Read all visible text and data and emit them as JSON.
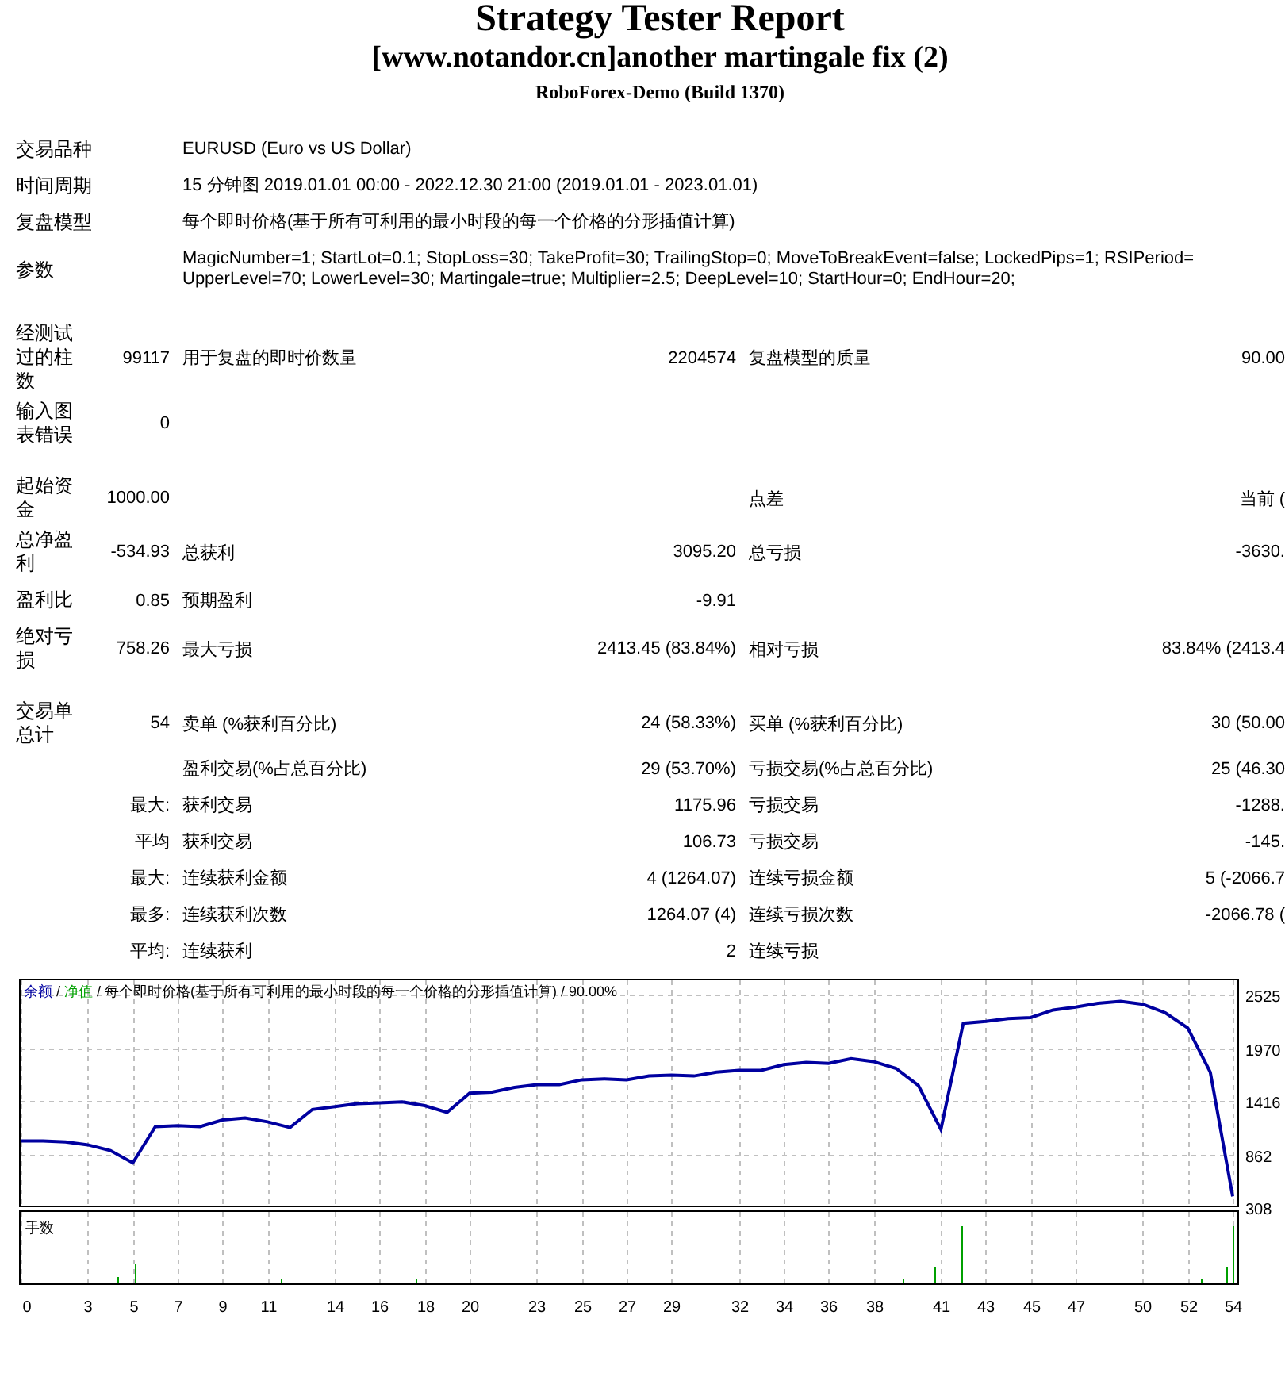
{
  "header": {
    "title": "Strategy Tester Report",
    "subtitle": "[www.notandor.cn]another martingale fix (2)",
    "server": "RoboForex-Demo (Build 1370)"
  },
  "info": [
    {
      "label": "交易品种",
      "value": "EURUSD (Euro vs US Dollar)"
    },
    {
      "label": "时间周期",
      "value": "15 分钟图 2019.01.01 00:00 - 2022.12.30 21:00 (2019.01.01 - 2023.01.01)"
    },
    {
      "label": "复盘模型",
      "value": "每个即时价格(基于所有可利用的最小时段的每一个价格的分形插值计算)"
    },
    {
      "label": "参数",
      "value": "MagicNumber=1; StartLot=0.1; StopLoss=30; TakeProfit=30; TrailingStop=0; MoveToBreakEvent=false; LockedPips=1; RSIPeriod= UpperLevel=70; LowerLevel=30; Martingale=true; Multiplier=2.5; DeepLevel=10; StartHour=0; EndHour=20;"
    }
  ],
  "sections": [
    [
      {
        "label": "经测试过的柱数",
        "value": "99117",
        "pairs": [
          {
            "label": "用于复盘的即时价数量",
            "value": "2204574"
          },
          {
            "label": "复盘模型的质量",
            "value": "90.00"
          }
        ]
      },
      {
        "label": "输入图表错误",
        "value": "0"
      }
    ],
    [
      {
        "label": "起始资金",
        "value": "1000.00",
        "right": {
          "label": "点差",
          "value": "当前 ("
        }
      },
      {
        "label": "总净盈利",
        "value": "-534.93",
        "pairs": [
          {
            "label": "总获利",
            "value": "3095.20"
          },
          {
            "label": "总亏损",
            "value": "-3630."
          }
        ]
      },
      {
        "label": "盈利比",
        "value": "0.85",
        "pairs": [
          {
            "label": "预期盈利",
            "value": "-9.91"
          }
        ]
      },
      {
        "label": "绝对亏损",
        "value": "758.26",
        "pairs": [
          {
            "label": "最大亏损",
            "value": "2413.45 (83.84%)"
          },
          {
            "label": "相对亏损",
            "value": "83.84% (2413.4"
          }
        ]
      }
    ],
    [
      {
        "label": "交易单总计",
        "value": "54",
        "pairs": [
          {
            "label": "卖单 (%获利百分比)",
            "value": "24 (58.33%)"
          },
          {
            "label": "买单 (%获利百分比)",
            "value": "30 (50.00"
          }
        ]
      },
      {
        "pairs": [
          {
            "label": "盈利交易(%占总百分比)",
            "value": "29 (53.70%)"
          },
          {
            "label": "亏损交易(%占总百分比)",
            "value": "25 (46.30"
          }
        ]
      },
      {
        "value": "最大:",
        "pairs": [
          {
            "label": "获利交易",
            "value": "1175.96"
          },
          {
            "label": "亏损交易",
            "value": "-1288."
          }
        ]
      },
      {
        "value": "平均",
        "pairs": [
          {
            "label": "获利交易",
            "value": "106.73"
          },
          {
            "label": "亏损交易",
            "value": "-145."
          }
        ]
      },
      {
        "value": "最大:",
        "pairs": [
          {
            "label": "连续获利金额",
            "value": "4 (1264.07)"
          },
          {
            "label": "连续亏损金额",
            "value": "5 (-2066.7"
          }
        ]
      },
      {
        "value": "最多:",
        "pairs": [
          {
            "label": "连续获利次数",
            "value": "1264.07 (4)"
          },
          {
            "label": "连续亏损次数",
            "value": "-2066.78 ("
          }
        ]
      },
      {
        "value": "平均:",
        "pairs": [
          {
            "label": "连续获利",
            "value": "2"
          },
          {
            "label": "连续亏损"
          }
        ]
      }
    ]
  ],
  "chart": {
    "legend": [
      {
        "text": " / ",
        "color": "#000000"
      },
      {
        "text": "净值",
        "color": "#00a000"
      },
      {
        "text": " / 每个即时价格(基于所有可利用的最小时段的每一个价格的分形插值计算) / 90.00%",
        "color": "#000000"
      }
    ],
    "volume_label": "手数",
    "chart_data": {
      "type": "line",
      "x": [
        0,
        1,
        2,
        3,
        4,
        5,
        6,
        7,
        8,
        9,
        10,
        11,
        12,
        13,
        14,
        15,
        16,
        17,
        18,
        19,
        20,
        21,
        22,
        23,
        24,
        25,
        26,
        27,
        28,
        29,
        30,
        31,
        32,
        33,
        34,
        35,
        36,
        37,
        38,
        39,
        40,
        41,
        42,
        43,
        44,
        45,
        46,
        47,
        48,
        49,
        50,
        51,
        52,
        53,
        54
      ],
      "series": [
        {
          "name": "余额",
          "color": "#0000a0",
          "values": [
            1000,
            1000,
            990,
            960,
            900,
            770,
            1150,
            1160,
            1150,
            1220,
            1240,
            1200,
            1140,
            1330,
            1360,
            1390,
            1400,
            1410,
            1370,
            1300,
            1500,
            1510,
            1560,
            1590,
            1590,
            1640,
            1650,
            1640,
            1680,
            1690,
            1680,
            1720,
            1740,
            1740,
            1800,
            1820,
            1810,
            1860,
            1830,
            1760,
            1580,
            1120,
            2230,
            2250,
            2280,
            2290,
            2370,
            2400,
            2440,
            2460,
            2430,
            2340,
            2180,
            1720,
            420
          ]
        }
      ],
      "grid": true,
      "xlim": [
        0,
        54
      ],
      "ylim": [
        308,
        2680
      ],
      "yticks": [
        308,
        862,
        1416,
        1970,
        2525
      ],
      "xticks": [
        0,
        3,
        5,
        7,
        9,
        11,
        14,
        16,
        18,
        20,
        23,
        25,
        27,
        29,
        32,
        34,
        36,
        38,
        41,
        43,
        45,
        47,
        50,
        52,
        54
      ]
    }
  }
}
